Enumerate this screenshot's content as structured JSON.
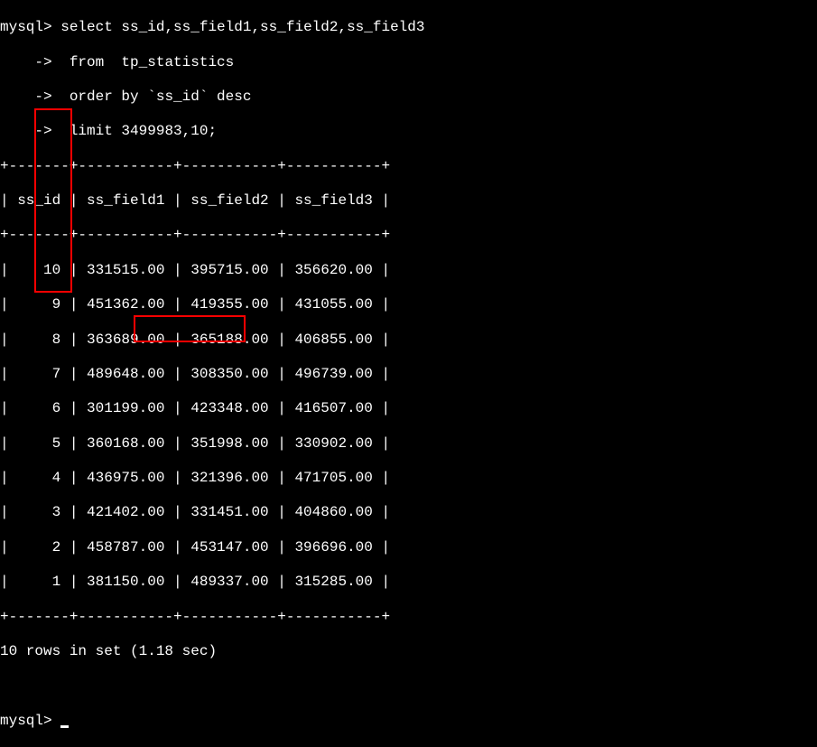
{
  "prompt1": "mysql> ",
  "query_line1": "select ss_id,ss_field1,ss_field2,ss_field3",
  "arrow": "    -> ",
  "query_line2": " from  tp_statistics",
  "query_line3": " order by `ss_id` desc",
  "query_line4": " limit 3499983,10;",
  "separator": "+-------+-----------+-----------+-----------+",
  "header_row": "| ss_id | ss_field1 | ss_field2 | ss_field3 |",
  "rows": [
    "|    10 | 331515.00 | 395715.00 | 356620.00 |",
    "|     9 | 451362.00 | 419355.00 | 431055.00 |",
    "|     8 | 363689.00 | 365188.00 | 406855.00 |",
    "|     7 | 489648.00 | 308350.00 | 496739.00 |",
    "|     6 | 301199.00 | 423348.00 | 416507.00 |",
    "|     5 | 360168.00 | 351998.00 | 330902.00 |",
    "|     4 | 436975.00 | 321396.00 | 471705.00 |",
    "|     3 | 421402.00 | 331451.00 | 404860.00 |",
    "|     2 | 458787.00 | 453147.00 | 396696.00 |",
    "|     1 | 381150.00 | 489337.00 | 315285.00 |"
  ],
  "result_status": "10 rows in set (1.18 sec)",
  "prompt2": "mysql> ",
  "chart_data": {
    "type": "table",
    "columns": [
      "ss_id",
      "ss_field1",
      "ss_field2",
      "ss_field3"
    ],
    "data": [
      {
        "ss_id": 10,
        "ss_field1": 331515.0,
        "ss_field2": 395715.0,
        "ss_field3": 356620.0
      },
      {
        "ss_id": 9,
        "ss_field1": 451362.0,
        "ss_field2": 419355.0,
        "ss_field3": 431055.0
      },
      {
        "ss_id": 8,
        "ss_field1": 363689.0,
        "ss_field2": 365188.0,
        "ss_field3": 406855.0
      },
      {
        "ss_id": 7,
        "ss_field1": 489648.0,
        "ss_field2": 308350.0,
        "ss_field3": 496739.0
      },
      {
        "ss_id": 6,
        "ss_field1": 301199.0,
        "ss_field2": 423348.0,
        "ss_field3": 416507.0
      },
      {
        "ss_id": 5,
        "ss_field1": 360168.0,
        "ss_field2": 351998.0,
        "ss_field3": 330902.0
      },
      {
        "ss_id": 4,
        "ss_field1": 436975.0,
        "ss_field2": 321396.0,
        "ss_field3": 471705.0
      },
      {
        "ss_id": 3,
        "ss_field1": 421402.0,
        "ss_field2": 331451.0,
        "ss_field3": 404860.0
      },
      {
        "ss_id": 2,
        "ss_field1": 458787.0,
        "ss_field2": 453147.0,
        "ss_field3": 396696.0
      },
      {
        "ss_id": 1,
        "ss_field1": 381150.0,
        "ss_field2": 489337.0,
        "ss_field3": 315285.0
      }
    ],
    "rows_returned": 10,
    "execution_time_sec": 1.18
  }
}
